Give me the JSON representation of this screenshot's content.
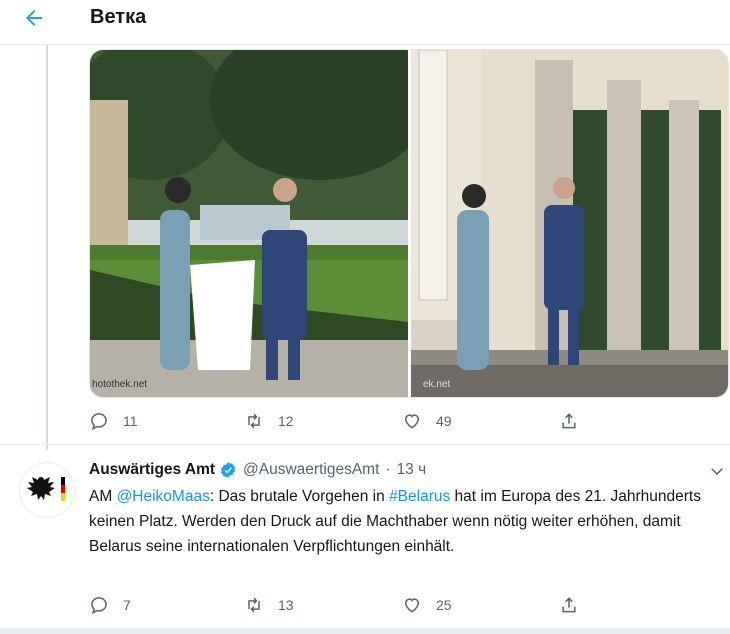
{
  "header": {
    "title": "Ветка"
  },
  "media": {
    "watermark_left": "hotothek.net",
    "watermark_right": "ek.net"
  },
  "first_tweet": {
    "actions": {
      "replies": "11",
      "retweets": "12",
      "likes": "49"
    }
  },
  "reply_tweet": {
    "author": "Auswärtiges Amt",
    "handle": "@AuswaertigesAmt",
    "dot": "·",
    "time": "13 ч",
    "body": {
      "prefix": "AM ",
      "mention": "@HeikoMaas",
      "text1": ": Das brutale Vorgehen in ",
      "hashtag": "#Belarus",
      "text2": " hat im Europa des 21. Jahrhunderts keinen Platz. Werden den Druck auf die Machthaber wenn nötig weiter erhöhen, damit Belarus seine internationalen Verpflichtungen einhält."
    },
    "actions": {
      "replies": "7",
      "retweets": "13",
      "likes": "25"
    }
  },
  "colors": {
    "accent": "#1da1f2",
    "link": "#1b95e0",
    "muted": "#536471"
  }
}
